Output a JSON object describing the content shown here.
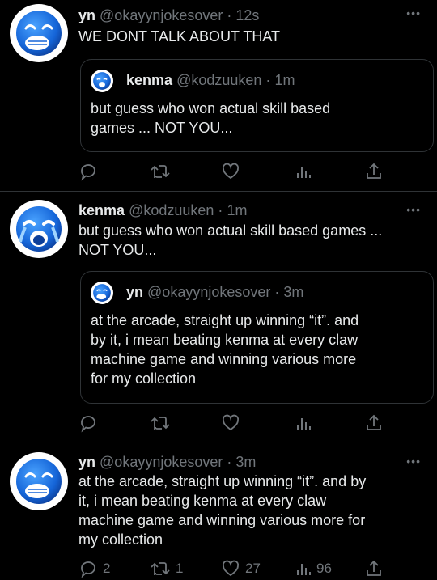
{
  "tweets": [
    {
      "name": "yn",
      "handle": "@okayynjokesover",
      "dot": "·",
      "time": "12s",
      "text": "WE DONT TALK ABOUT THAT",
      "more": "•••",
      "avatar_icon": "blue-emoji-hand-over-mouth",
      "quote": {
        "name": "kenma",
        "handle": "@kodzuuken",
        "dot": "·",
        "time": "1m",
        "line1": "but guess who won actual skill based",
        "line2": "games ... NOT YOU...",
        "avatar_icon": "blue-emoji-crying"
      },
      "counts": {
        "reply": "",
        "retweet": "",
        "like": "",
        "views": ""
      }
    },
    {
      "name": "kenma",
      "handle": "@kodzuuken",
      "dot": "·",
      "time": "1m",
      "line1": "but guess who won actual skill based games ...",
      "line2": "NOT YOU...",
      "more": "•••",
      "avatar_icon": "blue-emoji-crying",
      "quote": {
        "name": "yn",
        "handle": "@okayynjokesover",
        "dot": "·",
        "time": "3m",
        "line1": "at the arcade, straight up winning “it”. and",
        "line2": "by it, i mean beating kenma at every claw",
        "line3": "machine game and winning various more",
        "line4": "for my collection",
        "avatar_icon": "blue-emoji-hand-over-mouth"
      },
      "counts": {
        "reply": "",
        "retweet": "",
        "like": "",
        "views": ""
      }
    },
    {
      "name": "yn",
      "handle": "@okayynjokesover",
      "dot": "·",
      "time": "3m",
      "line1": "at the arcade, straight up winning “it”. and by",
      "line2": "it, i mean beating kenma at every claw",
      "line3": "machine game and winning various more for",
      "line4": "my collection",
      "more": "•••",
      "avatar_icon": "blue-emoji-hand-over-mouth",
      "counts": {
        "reply": "2",
        "retweet": "1",
        "like": "27",
        "views": "96"
      }
    }
  ],
  "icons": [
    "reply-icon",
    "retweet-icon",
    "like-icon",
    "views-icon",
    "share-icon"
  ],
  "colors": {
    "background": "#000000",
    "text": "#e7e9ea",
    "muted": "#71767b",
    "border": "#2f3336",
    "emoji_blue": "#1565d8"
  }
}
